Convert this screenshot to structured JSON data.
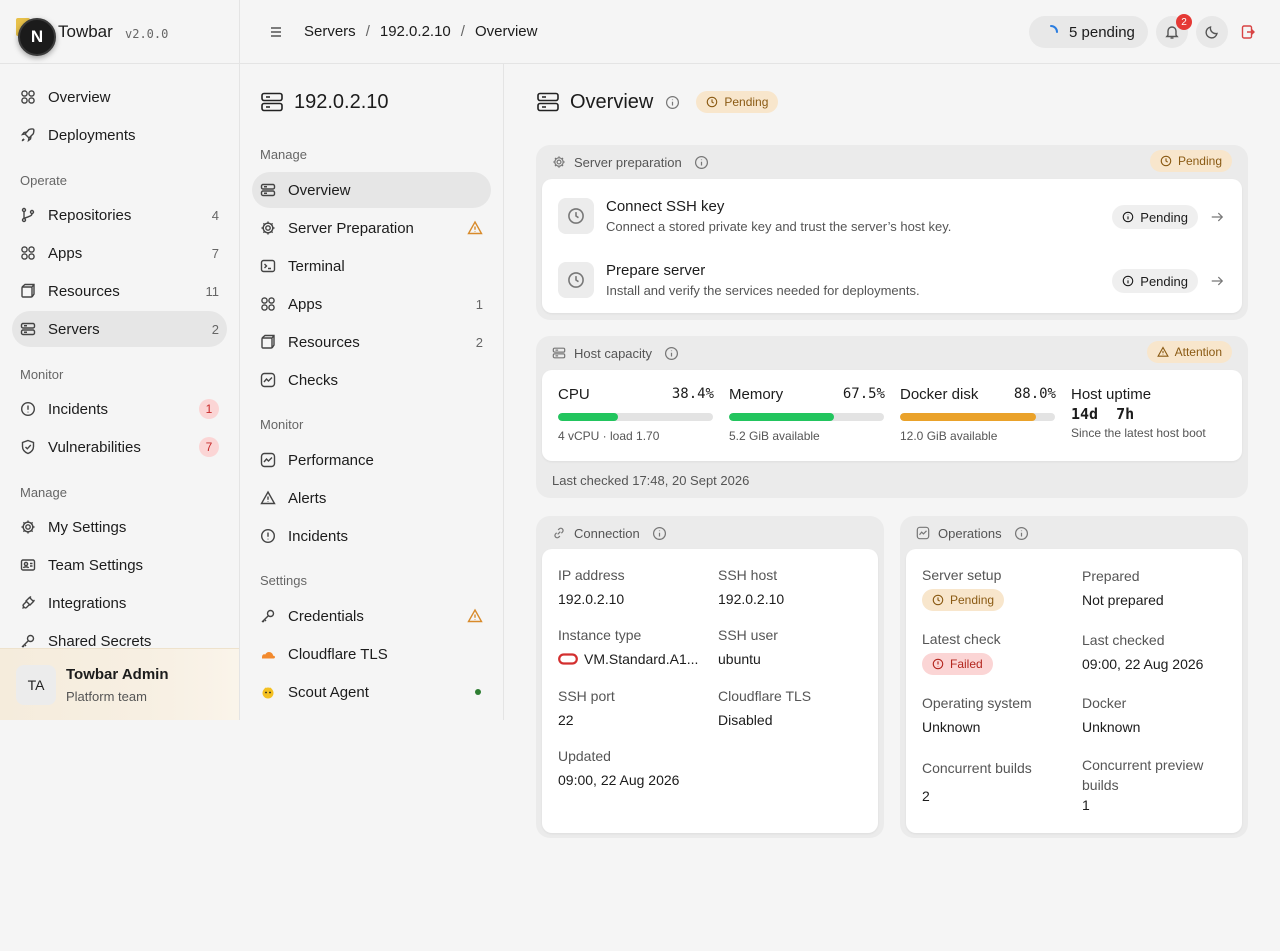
{
  "brand": {
    "logo_letter": "N",
    "name": "Towbar",
    "version": "v2.0.0"
  },
  "sidebar": {
    "items": [
      {
        "label": "Overview",
        "icon": "grid-icon"
      },
      {
        "label": "Deployments",
        "icon": "rocket-icon"
      }
    ],
    "sections": [
      {
        "title": "Operate",
        "items": [
          {
            "label": "Repositories",
            "count": "4",
            "icon": "git-branch-icon"
          },
          {
            "label": "Apps",
            "count": "7",
            "icon": "apps-icon"
          },
          {
            "label": "Resources",
            "count": "11",
            "icon": "box-icon"
          },
          {
            "label": "Servers",
            "count": "2",
            "icon": "server-icon",
            "active": true
          }
        ]
      },
      {
        "title": "Monitor",
        "items": [
          {
            "label": "Incidents",
            "count": "1",
            "icon": "alert-circle-icon"
          },
          {
            "label": "Vulnerabilities",
            "count": "7",
            "icon": "shield-icon"
          }
        ]
      },
      {
        "title": "Manage",
        "items": [
          {
            "label": "My Settings",
            "icon": "gear-icon"
          },
          {
            "label": "Team Settings",
            "icon": "team-icon"
          },
          {
            "label": "Integrations",
            "icon": "plug-icon"
          },
          {
            "label": "Shared Secrets",
            "icon": "key-icon"
          }
        ]
      }
    ],
    "user": {
      "initials": "TA",
      "name": "Towbar Admin",
      "team": "Platform team"
    }
  },
  "header": {
    "breadcrumbs": [
      "Servers",
      "192.0.2.10",
      "Overview"
    ],
    "pending_label": "5 pending",
    "notifications_count": "2"
  },
  "subnav": {
    "title": "192.0.2.10",
    "sections": [
      {
        "title": "Manage",
        "items": [
          {
            "label": "Overview",
            "icon": "server-icon",
            "active": true
          },
          {
            "label": "Server Preparation",
            "icon": "gear-icon",
            "warn": true
          },
          {
            "label": "Terminal",
            "icon": "terminal-icon"
          },
          {
            "label": "Apps",
            "count": "1",
            "icon": "apps-icon"
          },
          {
            "label": "Resources",
            "count": "2",
            "icon": "box-icon"
          },
          {
            "label": "Checks",
            "icon": "activity-icon"
          }
        ]
      },
      {
        "title": "Monitor",
        "items": [
          {
            "label": "Performance",
            "icon": "activity-icon"
          },
          {
            "label": "Alerts",
            "icon": "warning-icon"
          },
          {
            "label": "Incidents",
            "icon": "alert-circle-icon"
          }
        ]
      },
      {
        "title": "Settings",
        "items": [
          {
            "label": "Credentials",
            "icon": "key-icon",
            "warn": true
          },
          {
            "label": "Cloudflare TLS",
            "icon": "cloud-icon"
          },
          {
            "label": "Scout Agent",
            "icon": "scout-icon",
            "dot": true
          }
        ]
      }
    ]
  },
  "page": {
    "title": "Overview",
    "status": "Pending"
  },
  "prep": {
    "title": "Server preparation",
    "status": "Pending",
    "tasks": [
      {
        "title": "Connect SSH key",
        "desc": "Connect a stored private key and trust the server’s host key.",
        "status": "Pending"
      },
      {
        "title": "Prepare server",
        "desc": "Install and verify the services needed for deployments.",
        "status": "Pending"
      }
    ]
  },
  "capacity": {
    "title": "Host capacity",
    "status": "Attention",
    "metrics": [
      {
        "label": "CPU",
        "value": "38.4%",
        "fraction": 0.384,
        "sub": "4 vCPU · load 1.70",
        "color": "#22c55e"
      },
      {
        "label": "Memory",
        "value": "67.5%",
        "fraction": 0.675,
        "sub": "5.2 GiB available",
        "color": "#22c55e"
      },
      {
        "label": "Docker disk",
        "value": "88.0%",
        "fraction": 0.88,
        "sub": "12.0 GiB available",
        "color": "#eaa22a"
      }
    ],
    "uptime": {
      "label": "Host uptime",
      "value": "14d  7h",
      "sub": "Since the latest host boot"
    },
    "last_checked": "Last checked 17:48, 20 Sept 2026"
  },
  "connection": {
    "title": "Connection",
    "fields": {
      "ip_label": "IP address",
      "ip": "192.0.2.10",
      "ssh_host_label": "SSH host",
      "ssh_host": "192.0.2.10",
      "instance_label": "Instance type",
      "instance": "VM.Standard.A1...",
      "ssh_user_label": "SSH user",
      "ssh_user": "ubuntu",
      "ssh_port_label": "SSH port",
      "ssh_port": "22",
      "tls_label": "Cloudflare TLS",
      "tls": "Disabled",
      "updated_label": "Updated",
      "updated": "09:00, 22 Aug 2026"
    }
  },
  "operations": {
    "title": "Operations",
    "fields": {
      "setup_label": "Server setup",
      "setup": "Pending",
      "prepared_label": "Prepared",
      "prepared": "Not prepared",
      "latest_check_label": "Latest check",
      "latest_check": "Failed",
      "last_checked_label": "Last checked",
      "last_checked": "09:00, 22 Aug 2026",
      "os_label": "Operating system",
      "os": "Unknown",
      "docker_label": "Docker",
      "docker": "Unknown",
      "builds_label": "Concurrent builds",
      "builds": "2",
      "preview_label": "Concurrent preview builds",
      "preview": "1"
    }
  }
}
